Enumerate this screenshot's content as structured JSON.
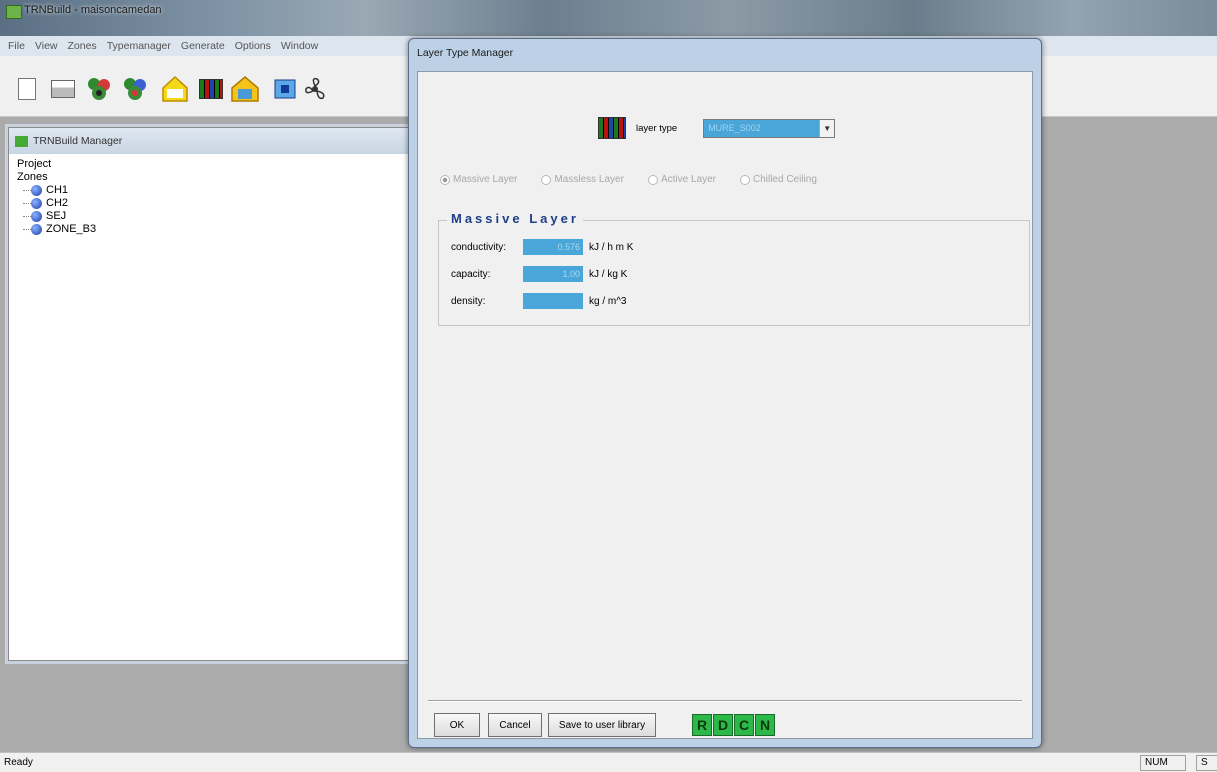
{
  "app": {
    "title": "TRNBuild - maisoncamedan"
  },
  "menu": [
    "File",
    "View",
    "Zones",
    "Typemanager",
    "Generate",
    "Options",
    "Window"
  ],
  "toolbar": {
    "icons": [
      "new-file-icon",
      "open-folder-icon",
      "zones-icon",
      "zones-copy-icon",
      "house-outline-icon",
      "layer-stripes-icon",
      "house-roof-icon",
      "window-icon",
      "fan-icon"
    ]
  },
  "manager": {
    "title": "TRNBuild Manager",
    "tree": {
      "project_label": "Project",
      "zones_label": "Zones",
      "zones": [
        "CH1",
        "CH2",
        "SEJ",
        "ZONE_B3"
      ]
    }
  },
  "dialog": {
    "title": "Layer Type Manager",
    "layer_type_label": "layer type",
    "layer_type_value": "MURE_S002",
    "radios": [
      "Massive Layer",
      "Massless Layer",
      "Active Layer",
      "Chilled Ceiling"
    ],
    "group_title": "Massive Layer",
    "fields": [
      {
        "label": "conductivity:",
        "value": "0.576",
        "unit": "kJ / h m K"
      },
      {
        "label": "capacity:",
        "value": "1.00",
        "unit": "kJ / kg K"
      },
      {
        "label": "density:",
        "value": "",
        "unit": "kg / m^3"
      }
    ],
    "buttons": {
      "ok": "OK",
      "cancel": "Cancel",
      "save": "Save to user library"
    },
    "rdcn": [
      "R",
      "D",
      "C",
      "N"
    ]
  },
  "status": {
    "ready": "Ready",
    "num": "NUM",
    "extra": "S"
  },
  "colors": {
    "field_bg": "#4aa6d8",
    "rdcn_bg": "#2db84a",
    "group_title": "#1f3f8a"
  }
}
